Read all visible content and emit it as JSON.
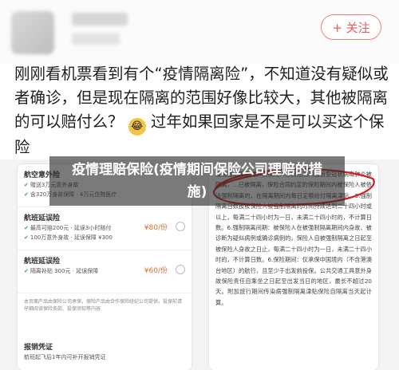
{
  "header": {
    "follow_label": "+ 关注"
  },
  "post": {
    "text_before_emoji": "刚刚看机票看到有个“疫情隔离险”，不知道没有疑似或者确诊，但是现在隔离的范围好像比较大，其他被隔离的可以赔付么？",
    "emoji": "😂",
    "text_after_emoji": "过年如果回家是不是可以买这个保险"
  },
  "overlay_title": "疫情理赔保险(疫情期间保险公司理赔的措施)",
  "left_screen": {
    "items": [
      {
        "title": "航空意外险",
        "lines": [
          "赠送3万元意外身故",
          "含320万身故保障 · 4万元住院医疗"
        ],
        "price": ""
      },
      {
        "title": "航班延误险",
        "lines": [
          "最高可赔200元 · 延误3小时赔付",
          "100万意外身故 · 延误保障 ¥300"
        ],
        "price": "¥80/份"
      },
      {
        "title": "航班延误险",
        "lines": [
          "隔离补贴 300元 · 延误保障"
        ],
        "price": "¥60/份"
      }
    ],
    "disclaimer": "本页面产品由保险公司承保，保险产品由合作保险经纪公司提供，投保前请仔细阅读保险条款、投保须知等内容",
    "voucher_title": "报销凭证",
    "voucher_line": "航班起飞后1年内可补开报销凭证"
  },
  "right_screen": {
    "text": "疫情强制隔离险，被保险人在保险期间因新型冠状病毒肺炎被隔离，...已被隔离，保险合同约定的保险期间内被保险人被依法强制隔离的，在隔离期间内每日定额给付隔离津贴。5.强制隔离日数按被保险人被强制隔离的时间持续达到二十四小时或以上，每满二十四小时为一日，未满二十四小时的，不计算日数。6.强制隔离间期：被保险人在被强制隔离期间内身故、被诊断为疑似病例或确诊病例的，保险人自被强制隔离之日起至被保险人身故之日止，每满二十四小时为一日，未满二十四小时的，不计算日数。6.保险期间：仅承保中国境内（不含港澳台地区）的航行，且至少于出发前投保。公共交通工具意外身故保险责任自乘坐之日起至出发当日的地区，最长不超过20天。附加旅行期间传染病强制隔离津贴保险自隔离当天起计算。"
  }
}
